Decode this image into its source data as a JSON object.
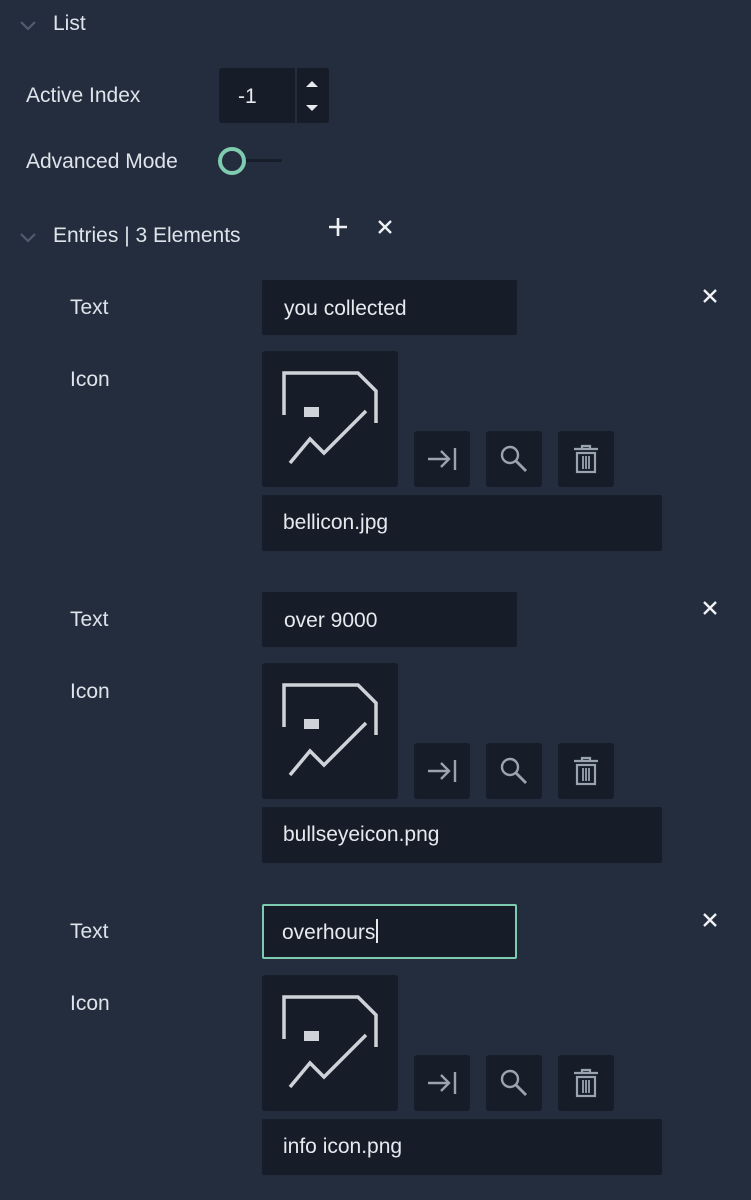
{
  "list_section": {
    "title": "List"
  },
  "active_index": {
    "label": "Active Index",
    "value": "-1"
  },
  "advanced_mode": {
    "label": "Advanced Mode",
    "enabled": false
  },
  "entries_section": {
    "title": "Entries | 3 Elements",
    "add_icon": "plus-icon",
    "clear_icon": "close-icon"
  },
  "entries": [
    {
      "text_label": "Text",
      "text_value": "you collected",
      "icon_label": "Icon",
      "icon_file": "bellicon.jpg",
      "focused": false
    },
    {
      "text_label": "Text",
      "text_value": "over 9000",
      "icon_label": "Icon",
      "icon_file": "bullseyeicon.png",
      "focused": false
    },
    {
      "text_label": "Text",
      "text_value": "overhours",
      "icon_label": "Icon",
      "icon_file": "info icon.png",
      "focused": true
    }
  ],
  "colors": {
    "background": "#232d3d",
    "field": "#161d28",
    "accent": "#7ecbb0",
    "text": "#dfe3ea"
  }
}
